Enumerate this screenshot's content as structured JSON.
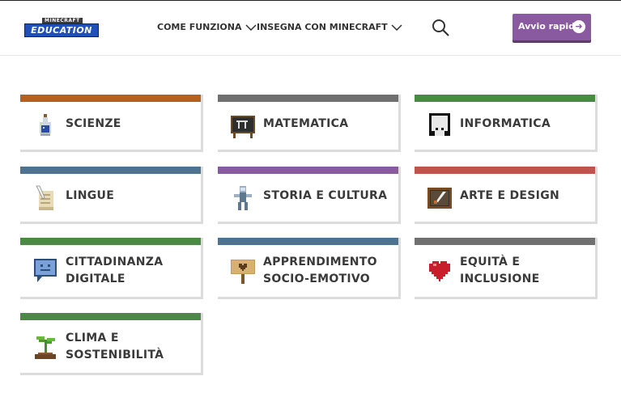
{
  "header": {
    "logo": {
      "top_text": "MINECRAFT",
      "main_text": "EDUCATION"
    },
    "nav": [
      {
        "label": "COME FUNZIONA"
      },
      {
        "label": "INSEGNA CON MINECRAFT"
      }
    ],
    "quick_start": "Avvio rapido",
    "quick_start_arrow": "➜"
  },
  "subjects": [
    {
      "label": "SCIENZE",
      "color": "#b5601c",
      "icon": "potion-icon"
    },
    {
      "label": "MATEMATICA",
      "color": "#707070",
      "icon": "chalkboard-icon"
    },
    {
      "label": "INFORMATICA",
      "color": "#4a8a44",
      "icon": "computer-icon"
    },
    {
      "label": "LINGUE",
      "color": "#4e7390",
      "icon": "book-quill-icon"
    },
    {
      "label": "STORIA E CULTURA",
      "color": "#8a5aa0",
      "icon": "statue-icon"
    },
    {
      "label": "ARTE E DESIGN",
      "color": "#c4524c",
      "icon": "painting-icon"
    },
    {
      "label": "CITTADINANZA DIGITALE",
      "line1": "CITTADINANZA",
      "line2": "DIGITALE",
      "color": "#4a8a44",
      "icon": "chat-bubble-icon"
    },
    {
      "label": "APPRENDIMENTO SOCIO-EMOTIVO",
      "line1": "APPRENDIMENTO",
      "line2": "SOCIO-EMOTIVO",
      "color": "#4e7390",
      "icon": "heart-sign-icon"
    },
    {
      "label": "EQUITÀ E INCLUSIONE",
      "line1": "EQUITÀ E",
      "line2": "INCLUSIONE",
      "color": "#707070",
      "icon": "heart-icon"
    },
    {
      "label": "CLIMA E SOSTENIBILITÀ",
      "line1": "CLIMA E",
      "line2": "SOSTENIBILITÀ",
      "color": "#4a8a44",
      "icon": "sprout-icon"
    }
  ]
}
